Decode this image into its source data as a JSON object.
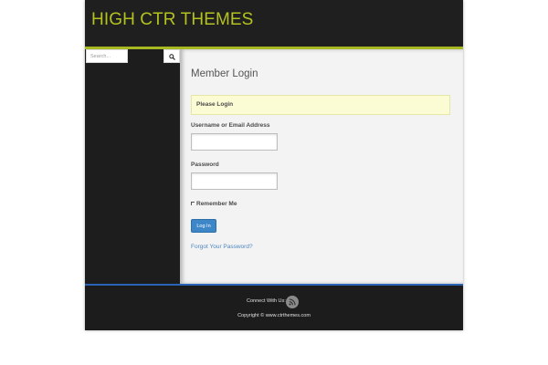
{
  "header": {
    "site_title": "HIGH CTR THEMES"
  },
  "sidebar": {
    "search": {
      "placeholder": "Search..."
    },
    "search_icon": "search-icon"
  },
  "login": {
    "title": "Member Login",
    "notice": "Please Login",
    "username_label": "Username or Email Address",
    "username_value": "",
    "password_label": "Password",
    "password_value": "",
    "remember_label": "Remember Me",
    "remember_checked": false,
    "submit_label": "Log In",
    "forgot_label": "Forgot Your Password?"
  },
  "footer": {
    "connect_label": "Connect With Us:",
    "social_icon": "rss-icon",
    "copyright": "Copyright © www.ctrthemes.com"
  },
  "colors": {
    "title_accent": "#b4c21f",
    "header_border": "#a8b821",
    "footer_border": "#2a63b4",
    "button_blue": "#3d86c8",
    "link_blue": "#4f86c1",
    "notice_bg": "#fcfcd4"
  }
}
